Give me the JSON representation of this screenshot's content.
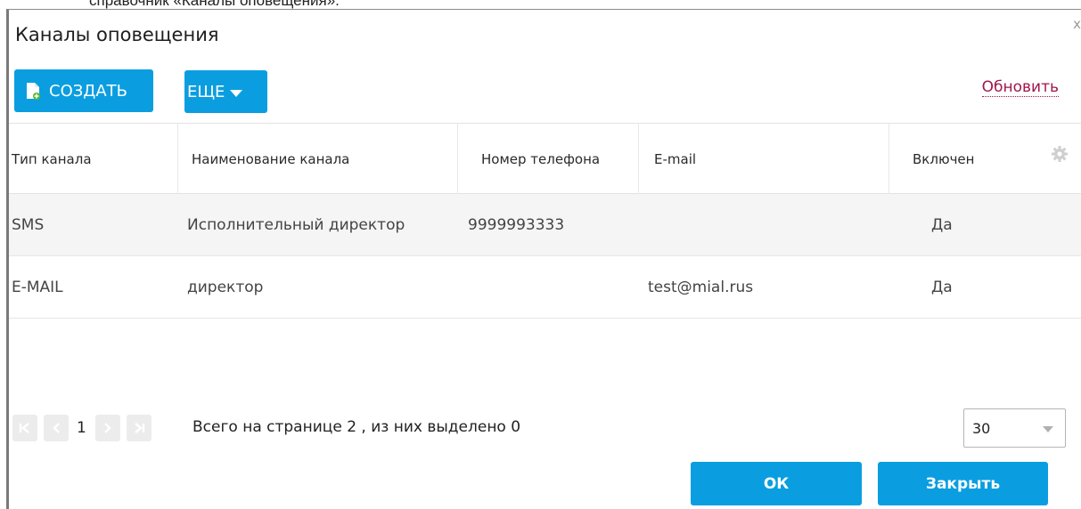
{
  "document": {
    "top_text": "справочник «Каналы оповещения»."
  },
  "dialog": {
    "title": "Каналы оповещения",
    "close_glyph": "x"
  },
  "toolbar": {
    "create_label": "СОЗДАТЬ",
    "more_label": "ЕЩЕ",
    "refresh_label": "Обновить"
  },
  "table": {
    "columns": [
      "Тип канала",
      "Наименование канала",
      "Номер телефона",
      "E-mail",
      "Включен"
    ],
    "rows": [
      {
        "type": "SMS",
        "name": "Исполнительный директор",
        "phone": "9999993333",
        "email": "",
        "enabled": "Да"
      },
      {
        "type": "E-MAIL",
        "name": "директор",
        "phone": "",
        "email": "test@mial.rus",
        "enabled": "Да"
      }
    ]
  },
  "pager": {
    "current_page": "1",
    "info": "Всего на странице 2 , из них выделено 0",
    "page_size": "30"
  },
  "footer": {
    "ok_label": "ОК",
    "close_label": "Закрыть"
  },
  "colors": {
    "accent": "#0a9ee0",
    "link": "#a0174a"
  }
}
